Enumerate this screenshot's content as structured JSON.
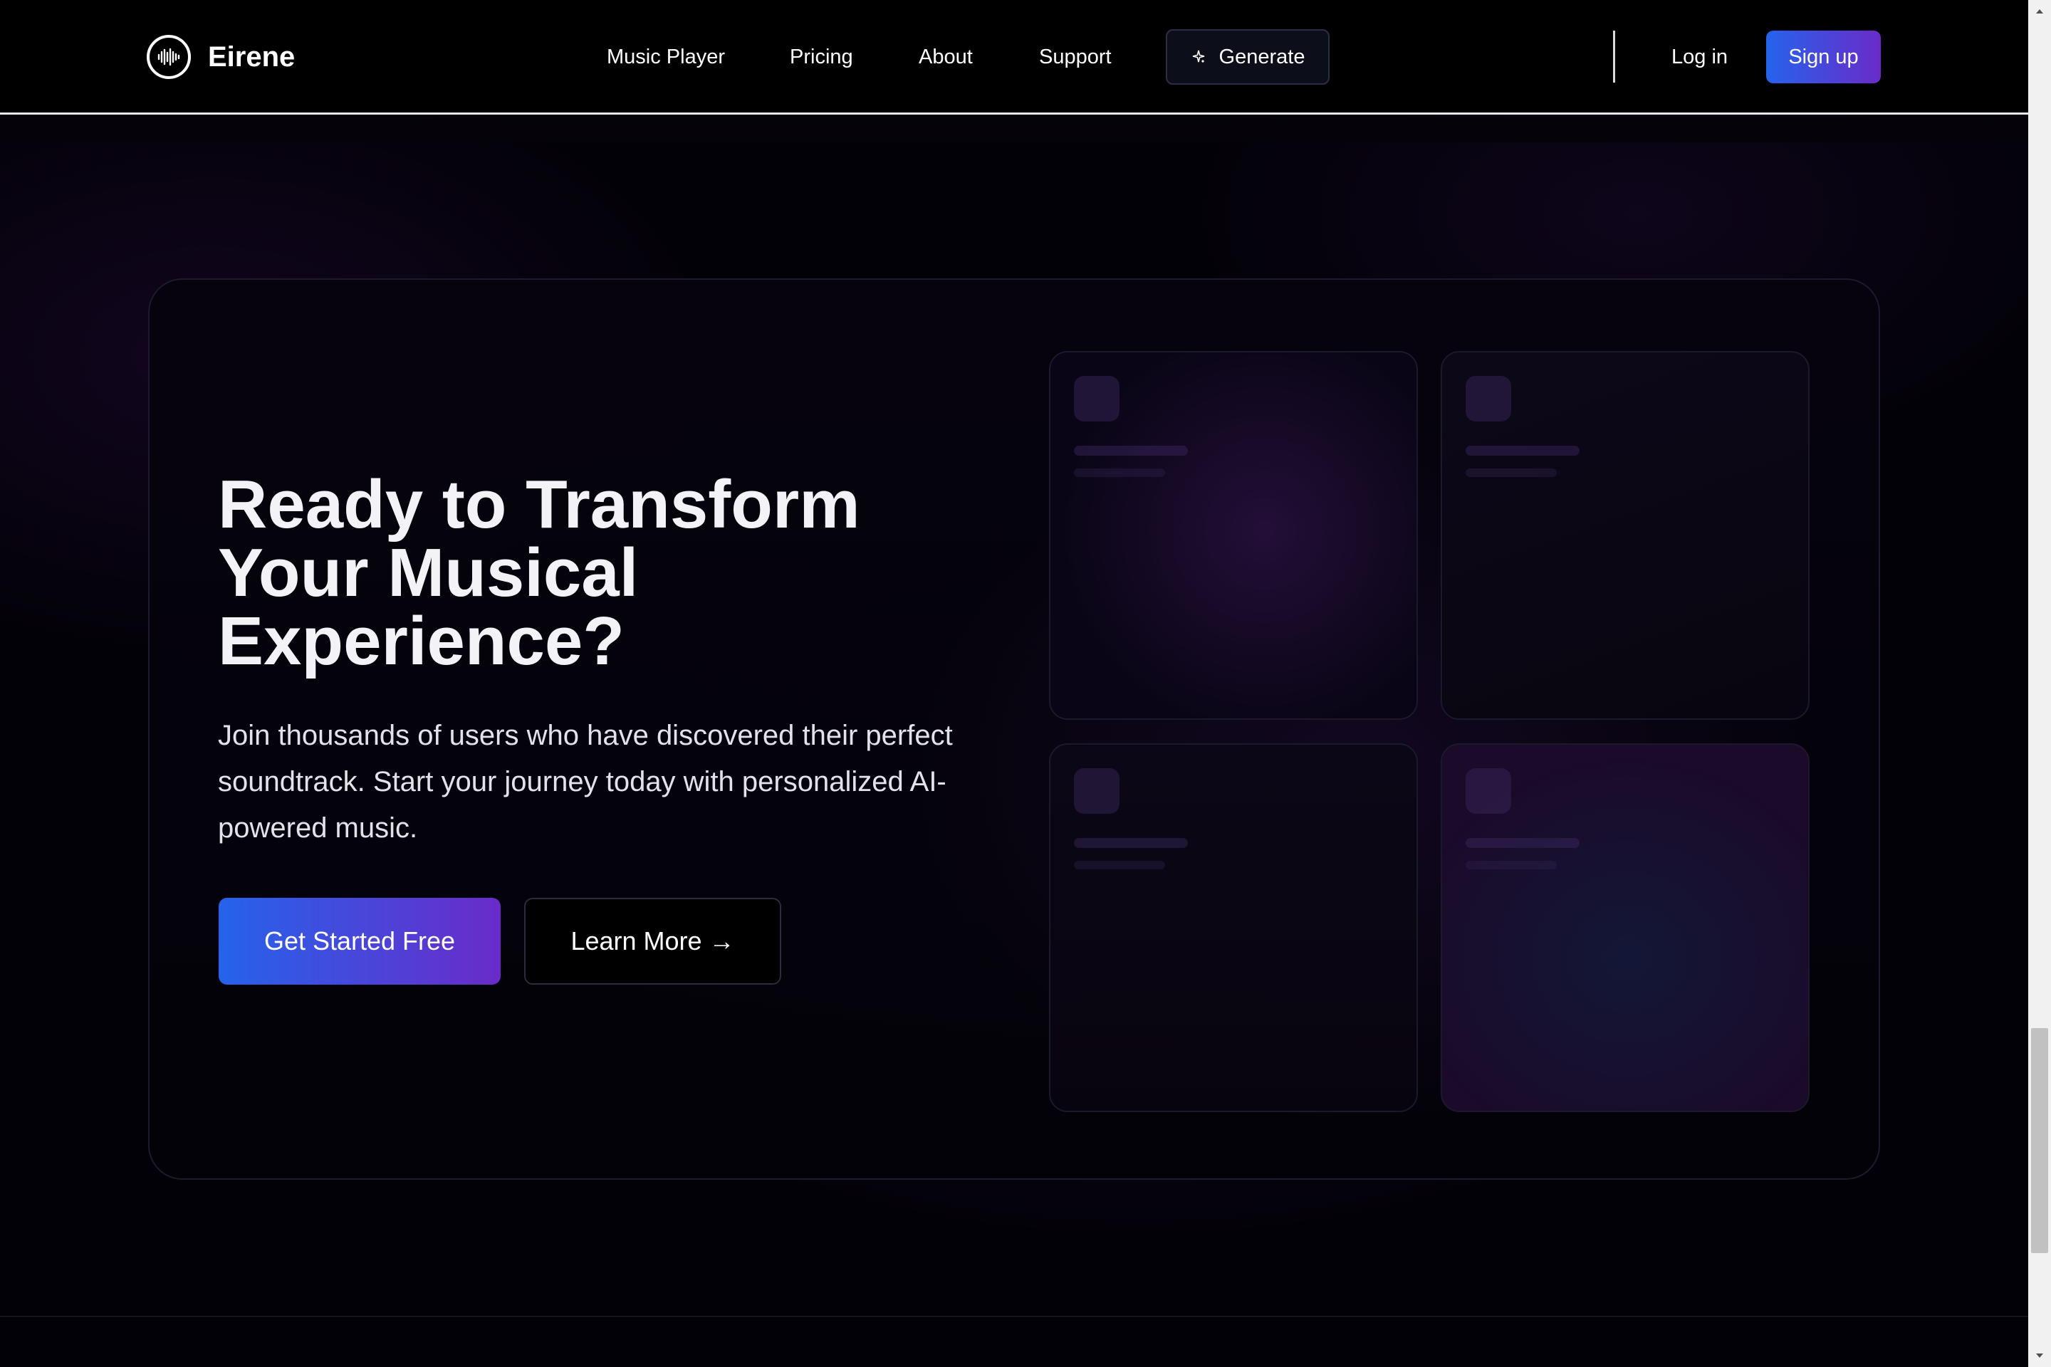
{
  "navbar": {
    "brand": {
      "name": "Eirene",
      "logo_icon": "waveform-icon"
    },
    "links": [
      {
        "label": "Music Player"
      },
      {
        "label": "Pricing"
      },
      {
        "label": "About"
      },
      {
        "label": "Support"
      }
    ],
    "generate_label": "Generate",
    "generate_icon": "sparkle-icon",
    "login_label": "Log in",
    "signup_label": "Sign up"
  },
  "cta": {
    "title_lines": [
      "Ready to Transform",
      "Your Musical",
      "Experience?"
    ],
    "description_lines": [
      "Join thousands of users who have discovered their perfect",
      "soundtrack. Start your journey today with personalized AI-",
      "powered music."
    ],
    "primary_button": "Get Started Free",
    "secondary_button": "Learn More →"
  },
  "colors": {
    "background": "#000000",
    "accent_gradient_start": "#2563eb",
    "accent_gradient_end": "#6a2bc9",
    "text": "#ffffff"
  }
}
